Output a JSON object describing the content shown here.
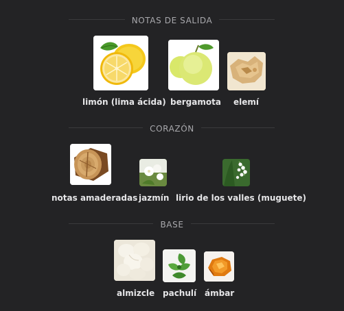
{
  "sections": [
    {
      "title": "NOTAS DE SALIDA",
      "notes": [
        {
          "name": "limón (lima ácida)",
          "icon": "lemon-icon"
        },
        {
          "name": "bergamota",
          "icon": "bergamot-icon"
        },
        {
          "name": "elemí",
          "icon": "elemi-resin-icon"
        }
      ]
    },
    {
      "title": "CORAZÓN",
      "notes": [
        {
          "name": "notas amaderadas",
          "icon": "wood-log-icon"
        },
        {
          "name": "jazmín",
          "icon": "jasmine-icon"
        },
        {
          "name": "lirio de los valles (muguete)",
          "icon": "lily-of-the-valley-icon"
        }
      ]
    },
    {
      "title": "BASE",
      "notes": [
        {
          "name": "almizcle",
          "icon": "musk-icon"
        },
        {
          "name": "pachulí",
          "icon": "patchouli-icon"
        },
        {
          "name": "ámbar",
          "icon": "amber-icon"
        }
      ]
    }
  ],
  "colors": {
    "background": "#232325",
    "section_title": "#a9a9ad",
    "note_label": "#e6e6e8"
  }
}
